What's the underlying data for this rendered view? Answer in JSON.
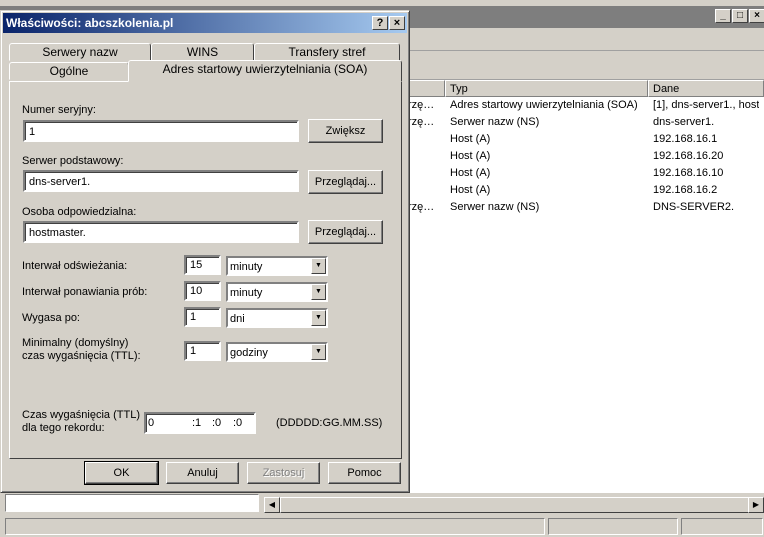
{
  "background": {
    "list": {
      "columns": [
        {
          "label": ""
        },
        {
          "label": "Typ"
        },
        {
          "label": "Dane"
        }
      ],
      "rows": [
        {
          "name": "rzę…",
          "type": "Adres startowy uwierzytelniania (SOA)",
          "data": "[1], dns-server1., host"
        },
        {
          "name": "rzę…",
          "type": "Serwer nazw (NS)",
          "data": "dns-server1."
        },
        {
          "name": "",
          "type": "Host (A)",
          "data": "192.168.16.1"
        },
        {
          "name": "",
          "type": "Host (A)",
          "data": "192.168.16.20"
        },
        {
          "name": "",
          "type": "Host (A)",
          "data": "192.168.16.10"
        },
        {
          "name": "",
          "type": "Host (A)",
          "data": "192.168.16.2"
        },
        {
          "name": "rzę…",
          "type": "Serwer nazw (NS)",
          "data": "DNS-SERVER2."
        }
      ]
    },
    "window_controls": {
      "minimize": "_",
      "maximize": "□",
      "close": "×"
    }
  },
  "dialog": {
    "title": "Właściwości: abcszkolenia.pl",
    "help_glyph": "?",
    "close_glyph": "×",
    "tabs_back": [
      "Serwery nazw",
      "WINS",
      "Transfery stref"
    ],
    "tabs_front": [
      "Ogólne",
      "Adres startowy uwierzytelniania (SOA)"
    ],
    "serial": {
      "label": "Numer seryjny:",
      "value": "1",
      "button": "Zwiększ"
    },
    "primary_server": {
      "label": "Serwer podstawowy:",
      "value": "dns-server1.",
      "button": "Przeglądaj..."
    },
    "responsible": {
      "label": "Osoba odpowiedzialna:",
      "value": "hostmaster.",
      "button": "Przeglądaj..."
    },
    "refresh": {
      "label": "Interwał odświeżania:",
      "value": "15",
      "unit": "minuty"
    },
    "retry": {
      "label": "Interwał ponawiania prób:",
      "value": "10",
      "unit": "minuty"
    },
    "expire": {
      "label": "Wygasa po:",
      "value": "1",
      "unit": "dni"
    },
    "min_ttl": {
      "label_line1": "Minimalny (domyślny)",
      "label_line2": "czas wygaśnięcia (TTL):",
      "value": "1",
      "unit": "godziny"
    },
    "record_ttl": {
      "label_line1": "Czas wygaśnięcia (TTL)",
      "label_line2": "dla tego rekordu:",
      "days": "0",
      "hours": ":1",
      "minutes": ":0",
      "seconds": ":0",
      "format": "(DDDDD:GG.MM.SS)"
    },
    "buttons": {
      "ok": "OK",
      "cancel": "Anuluj",
      "apply": "Zastosuj",
      "help": "Pomoc"
    }
  }
}
